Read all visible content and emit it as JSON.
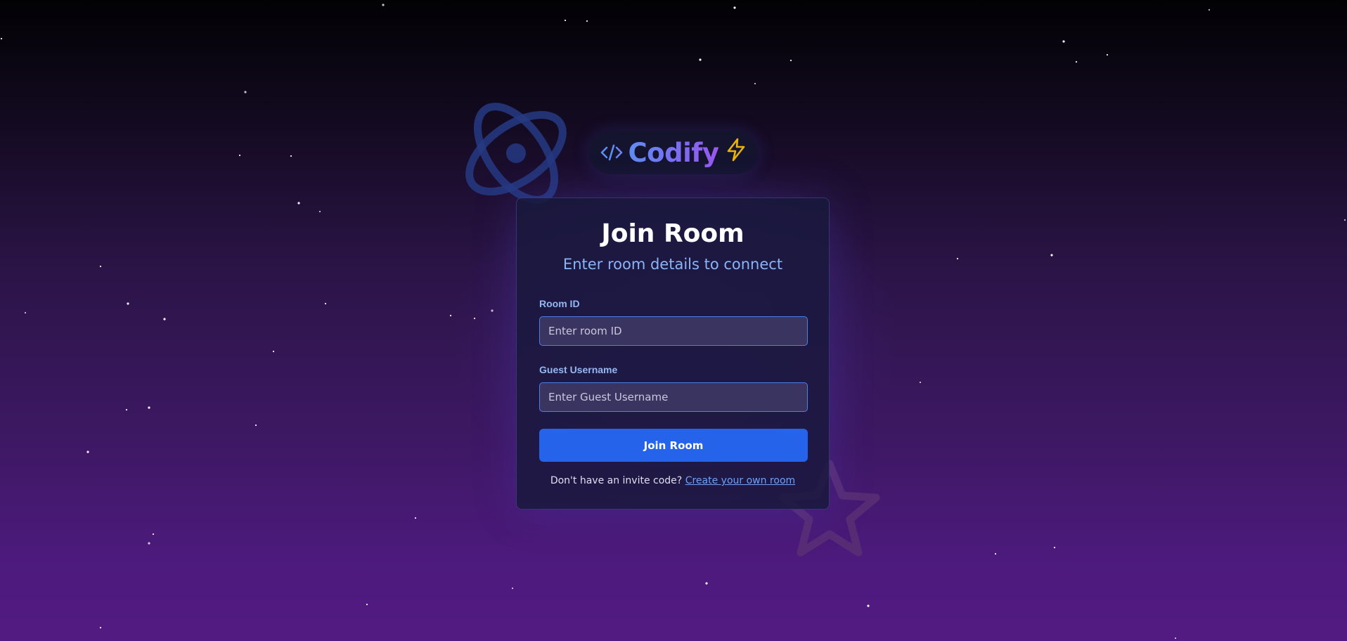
{
  "logo": {
    "text": "Codify",
    "left_icon": "code-icon",
    "right_icon": "lightning-bolt-icon"
  },
  "decorations": {
    "top_left": "atom-icon",
    "bottom_right": "star-icon"
  },
  "card": {
    "title": "Join Room",
    "subtitle": "Enter room details to connect"
  },
  "form": {
    "room_id": {
      "label": "Room ID",
      "placeholder": "Enter room ID",
      "value": ""
    },
    "guest_username": {
      "label": "Guest Username",
      "placeholder": "Enter Guest Username",
      "value": ""
    },
    "submit_label": "Join Room"
  },
  "footer": {
    "prompt": "Don't have an invite code?",
    "link_label": "Create your own room"
  },
  "colors": {
    "primary_button": "#2563eb",
    "accent_blue": "#8ab4f8",
    "link": "#6ea1f7",
    "bolt": "#eab308",
    "logo_gradient_start": "#5f8df2",
    "logo_gradient_end": "#9b57ee"
  }
}
